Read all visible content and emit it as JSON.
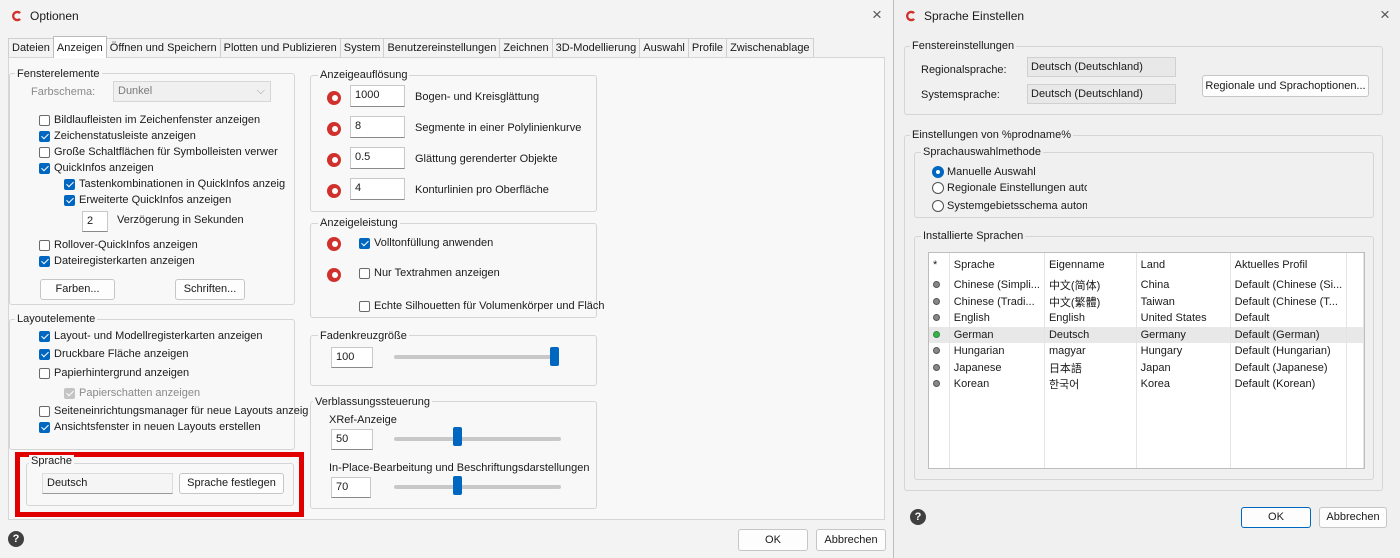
{
  "options_window": {
    "title": "Optionen",
    "close_glyph": "×",
    "tabs": [
      "Dateien",
      "Anzeigen",
      "Öffnen und Speichern",
      "Plotten und Publizieren",
      "System",
      "Benutzereinstellungen",
      "Zeichnen",
      "3D-Modellierung",
      "Auswahl",
      "Profile",
      "Zwischenablage"
    ],
    "active_tab": "Anzeigen",
    "fensterelemente": {
      "title": "Fensterelemente",
      "farbschema_label": "Farbschema:",
      "farbschema_value": "Dunkel",
      "items": [
        {
          "label": "Bildlaufleisten im Zeichenfenster anzeigen",
          "checked": false
        },
        {
          "label": "Zeichenstatusleiste anzeigen",
          "checked": true
        },
        {
          "label": "Große Schaltflächen für Symbolleisten verwer",
          "checked": false
        },
        {
          "label": "QuickInfos anzeigen",
          "checked": true
        },
        {
          "label": "Tastenkombinationen in QuickInfos anzeig",
          "checked": true
        },
        {
          "label": "Erweiterte QuickInfos anzeigen",
          "checked": true
        }
      ],
      "delay_value": "2",
      "delay_label": "Verzögerung in Sekunden",
      "items2": [
        {
          "label": "Rollover-QuickInfos anzeigen",
          "checked": false
        },
        {
          "label": "Dateiregisterkarten anzeigen",
          "checked": true
        }
      ],
      "farben_button": "Farben...",
      "schriften_button": "Schriften..."
    },
    "layoutelemente": {
      "title": "Layoutelemente",
      "items": [
        {
          "label": "Layout- und Modellregisterkarten anzeigen",
          "checked": true
        },
        {
          "label": "Druckbare Fläche anzeigen",
          "checked": true
        },
        {
          "label": "Papierhintergrund anzeigen",
          "checked": false
        },
        {
          "label": "Papierschatten anzeigen",
          "checked": true
        },
        {
          "label": "Seiteneinrichtungsmanager für neue Layouts anzeig",
          "checked": false
        },
        {
          "label": "Ansichtsfenster in neuen Layouts erstellen",
          "checked": true
        }
      ]
    },
    "sprache": {
      "title": "Sprache",
      "value": "Deutsch",
      "button": "Sprache festlegen",
      "highlight_color": "#e00000"
    },
    "anzeigeaufloesung": {
      "title": "Anzeigeauflösung",
      "rows": [
        {
          "value": "1000",
          "label": "Bogen- und Kreisglättung"
        },
        {
          "value": "8",
          "label": "Segmente in einer Polylinienkurve"
        },
        {
          "value": "0.5",
          "label": "Glättung gerenderter Objekte"
        },
        {
          "value": "4",
          "label": "Konturlinien pro Oberfläche"
        }
      ]
    },
    "anzeigeleistung": {
      "title": "Anzeigeleistung",
      "items": [
        {
          "label": "Volltonfüllung anwenden",
          "checked": true
        },
        {
          "label": "Nur Textrahmen anzeigen",
          "checked": false
        },
        {
          "label": "Echte Silhouetten für Volumenkörper und Fläch",
          "checked": false
        }
      ]
    },
    "fadenkreuz": {
      "title": "Fadenkreuzgröße",
      "value": "100",
      "level": 1.0
    },
    "verblassung": {
      "title": "Verblassungssteuerung",
      "xref_label": "XRef-Anzeige",
      "xref_value": "50",
      "xref_level": 0.5,
      "inplace_label": "In-Place-Bearbeitung und Beschriftungsdarstellungen",
      "inplace_value": "70",
      "inplace_level": 0.7
    },
    "ok_button": "OK",
    "cancel_button": "Abbrechen",
    "help_glyph": "?",
    "accent": "#0067c0"
  },
  "language_window": {
    "title": "Sprache Einstellen",
    "close_glyph": "×",
    "fenstereinstellungen": {
      "title": "Fenstereinstellungen",
      "regional_label": "Regionalsprache:",
      "regional_value": "Deutsch (Deutschland)",
      "system_label": "Systemsprache:",
      "system_value": "Deutsch (Deutschland)",
      "options_button": "Regionale und Sprachoptionen..."
    },
    "einstellungen": {
      "title": "Einstellungen von %prodname%",
      "method_title": "Sprachauswahlmethode",
      "methods": [
        {
          "label": "Manuelle Auswahl",
          "selected": true
        },
        {
          "label": "Regionale Einstellungen automatisch ¸",
          "selected": false
        },
        {
          "label": "Systemgebietsschema automatisch",
          "selected": false
        }
      ],
      "installed_title": "Installierte Sprachen",
      "columns": [
        "*",
        "Sprache",
        "Eigenname",
        "Land",
        "Aktuelles Profil"
      ],
      "rows": [
        {
          "status": "grey",
          "sprache": "Chinese (Simpli...",
          "eigenname": "中文(简体)",
          "land": "China",
          "profil": "Default (Chinese (Si..."
        },
        {
          "status": "grey",
          "sprache": "Chinese (Tradi...",
          "eigenname": "中文(繁體)",
          "land": "Taiwan",
          "profil": "Default (Chinese (T..."
        },
        {
          "status": "grey",
          "sprache": "English",
          "eigenname": "English",
          "land": "United States",
          "profil": "Default"
        },
        {
          "status": "green",
          "sprache": "German",
          "eigenname": "Deutsch",
          "land": "Germany",
          "profil": "Default (German)"
        },
        {
          "status": "grey",
          "sprache": "Hungarian",
          "eigenname": "magyar",
          "land": "Hungary",
          "profil": "Default (Hungarian)"
        },
        {
          "status": "grey",
          "sprache": "Japanese",
          "eigenname": "日本語",
          "land": "Japan",
          "profil": "Default (Japanese)"
        },
        {
          "status": "grey",
          "sprache": "Korean",
          "eigenname": "한국어",
          "land": "Korea",
          "profil": "Default (Korean)"
        }
      ],
      "selected_row": 3
    },
    "ok_button": "OK",
    "cancel_button": "Abbrechen",
    "help_glyph": "?"
  }
}
